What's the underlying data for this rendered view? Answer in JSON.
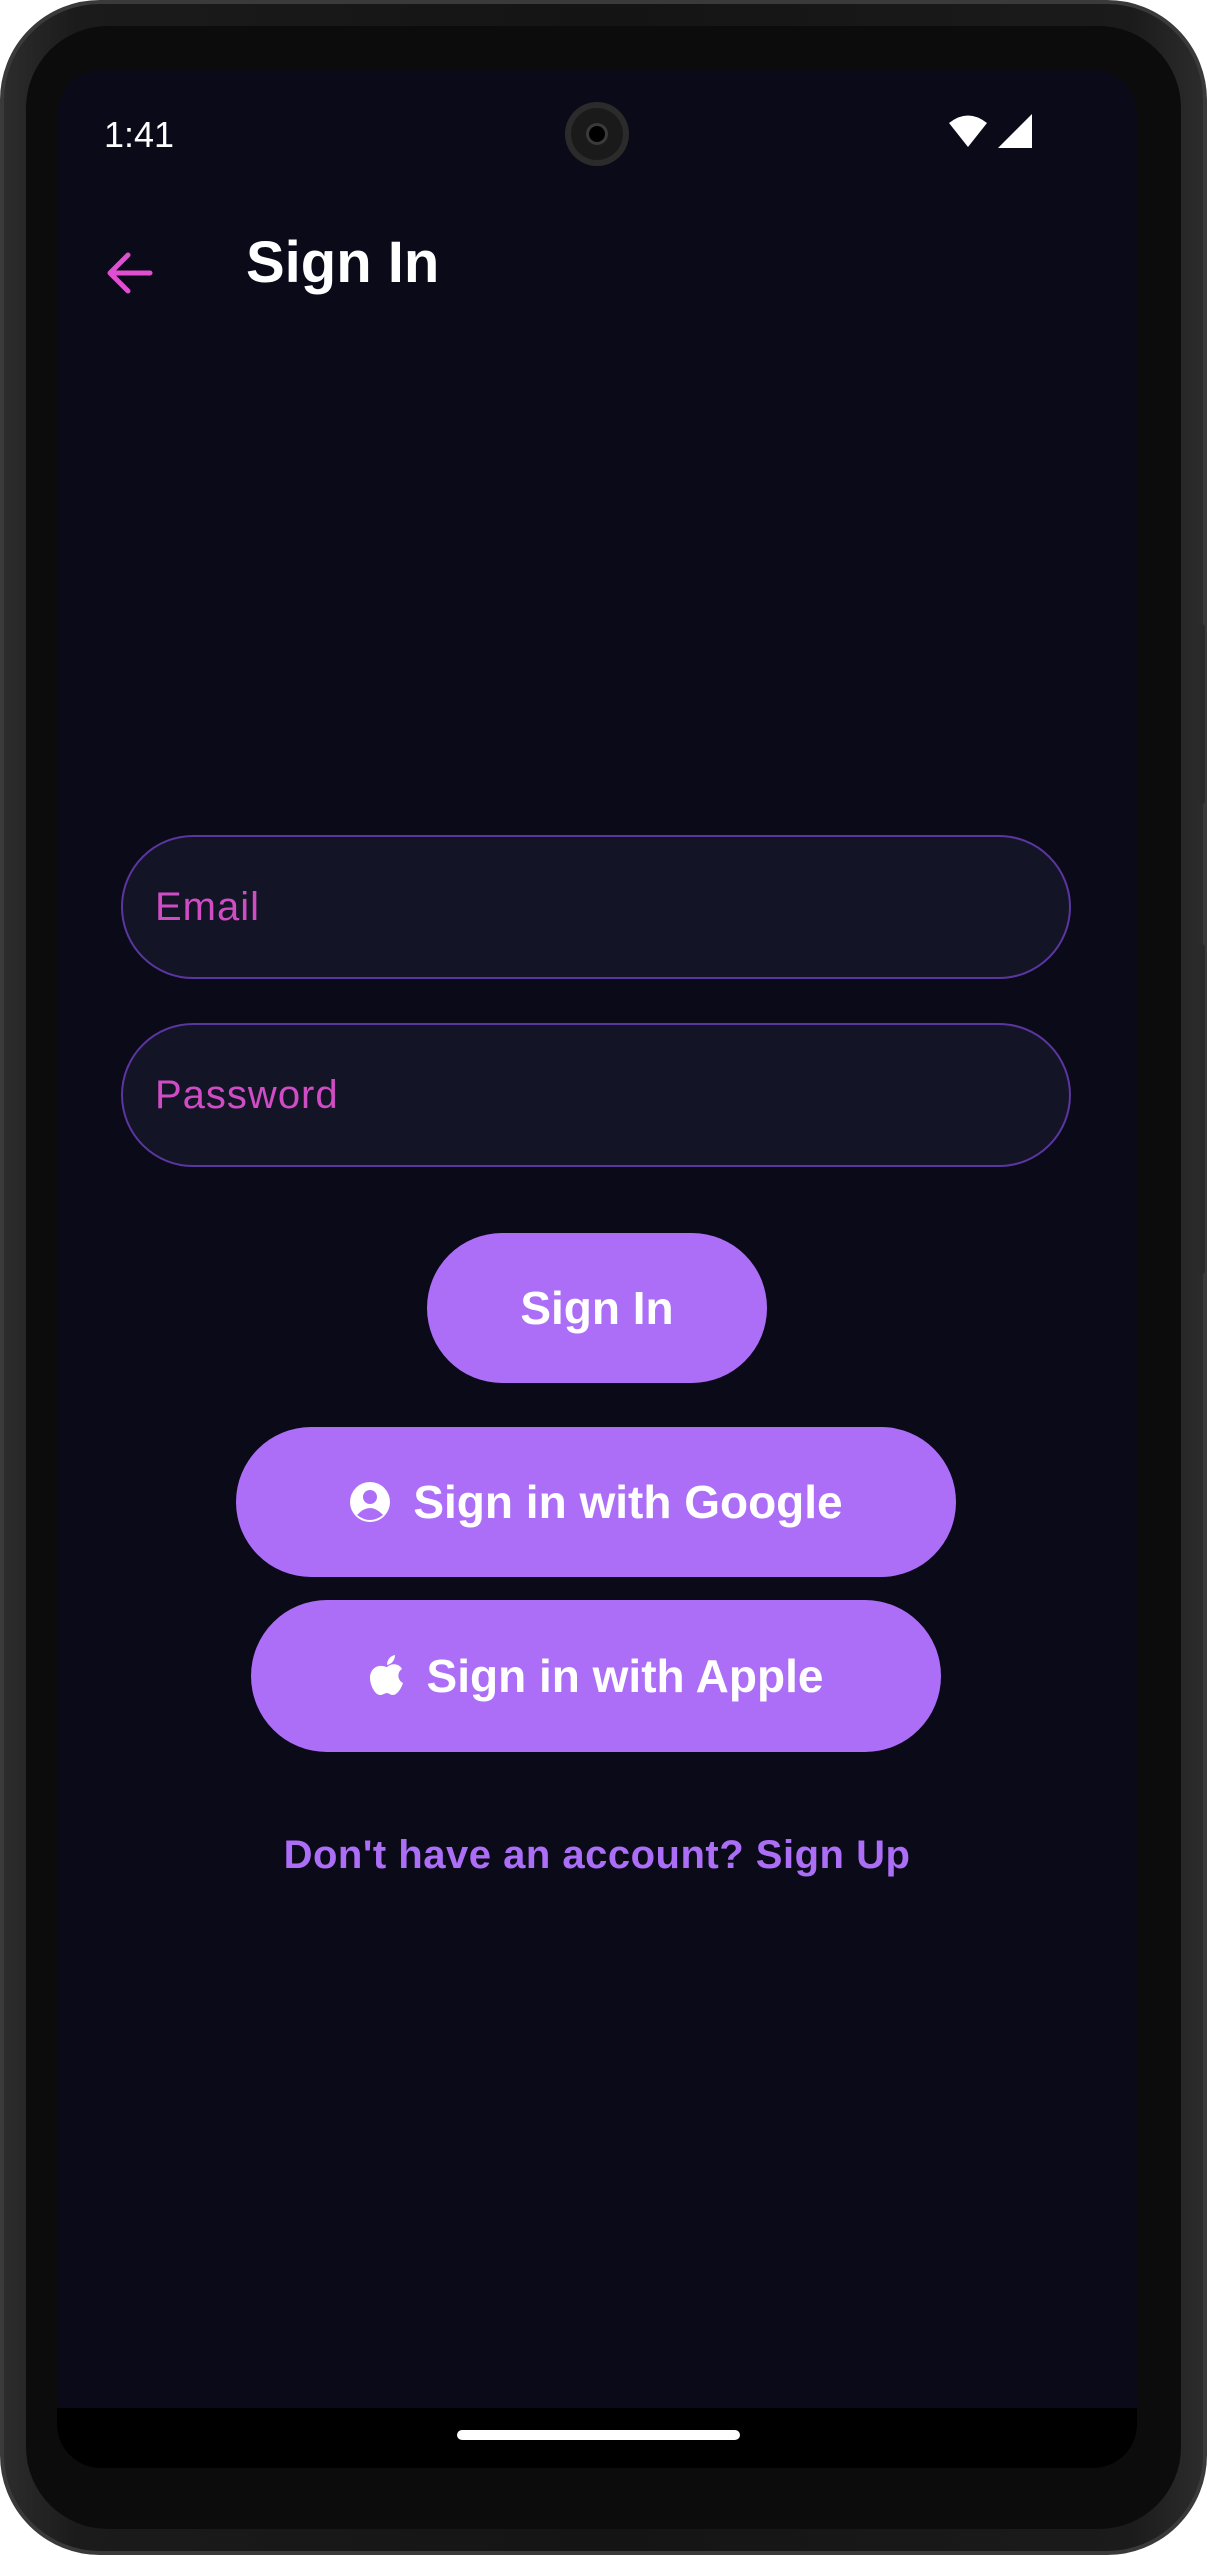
{
  "status_bar": {
    "time": "1:41",
    "icons": [
      "wifi-icon",
      "signal-icon"
    ]
  },
  "app_bar": {
    "back_icon": "arrow-left-icon",
    "title": "Sign In"
  },
  "form": {
    "email_placeholder": "Email",
    "email_value": "",
    "password_placeholder": "Password",
    "password_value": ""
  },
  "buttons": {
    "sign_in": "Sign In",
    "google": "Sign in with Google",
    "google_icon": "account-circle-icon",
    "apple": "Sign in with Apple",
    "apple_icon": "apple-icon"
  },
  "footer": {
    "signup_text": "Don't have an account? Sign Up"
  },
  "colors": {
    "background": "#0b0a19",
    "accent": "#ac6ef7",
    "placeholder": "#d04cc5",
    "field_border": "#5b35a0",
    "back_arrow": "#e04fd1"
  }
}
